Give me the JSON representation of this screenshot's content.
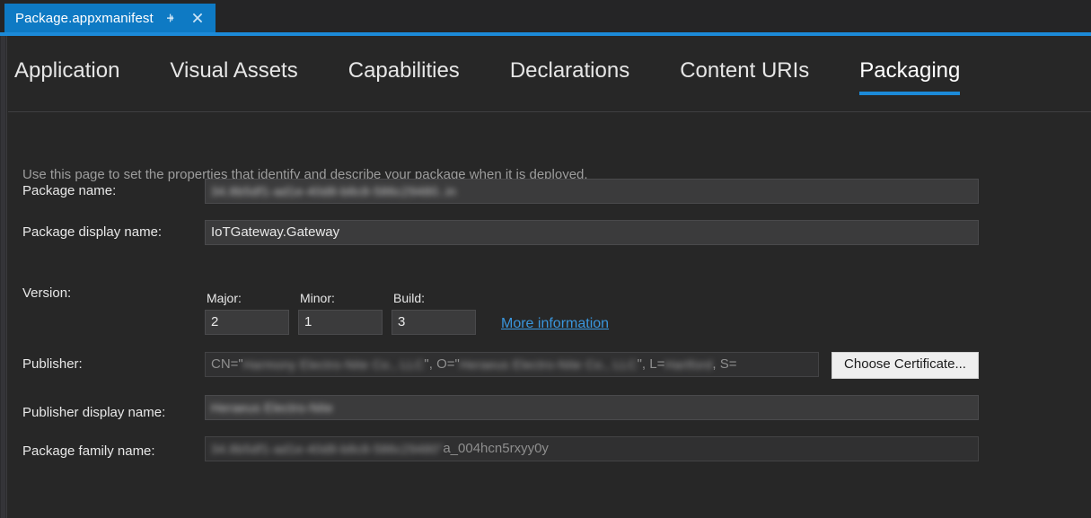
{
  "window": {
    "document_tab": {
      "title": "Package.appxmanifest",
      "pin_icon": "pin-icon",
      "close_icon": "close-icon"
    }
  },
  "accent_color": "#1c8ad8",
  "page_tabs": [
    {
      "label": "Application",
      "selected": false
    },
    {
      "label": "Visual Assets",
      "selected": false
    },
    {
      "label": "Capabilities",
      "selected": false
    },
    {
      "label": "Declarations",
      "selected": false
    },
    {
      "label": "Content URIs",
      "selected": false
    },
    {
      "label": "Packaging",
      "selected": true
    }
  ],
  "description": "Use this page to set the properties that identify and describe your package when it is deployed.",
  "fields": {
    "package_name": {
      "label": "Package name:",
      "value": "34.8b5df1-ad1e-40d8-b8c8-586c29480..in",
      "redacted": true
    },
    "package_display_name": {
      "label": "Package display name:",
      "value": "IoTGateway.Gateway",
      "redacted": false
    },
    "version": {
      "label": "Version:",
      "major": {
        "label": "Major:",
        "value": "2"
      },
      "minor": {
        "label": "Minor:",
        "value": "1"
      },
      "build": {
        "label": "Build:",
        "value": "3"
      },
      "more_info_link": "More information"
    },
    "publisher": {
      "label": "Publisher:",
      "prefix": "CN=\"",
      "redacted_1": "Harmony Electro-Nite Co., LLC",
      "mid_1": "\", O=\"",
      "redacted_2": "Heraeus Electro-Nite Co., LLC",
      "mid_2": "\", L=",
      "redacted_3": "Hartford",
      "suffix": ", S=",
      "choose_certificate_button": "Choose Certificate..."
    },
    "publisher_display_name": {
      "label": "Publisher display name:",
      "value": "Heraeus Electro-Nite",
      "redacted": true
    },
    "package_family_name": {
      "label": "Package family name:",
      "redacted_prefix": "34.8b5df1-ad1e-40d8-b8c8-586c29480\"",
      "visible_suffix": "a_004hcn5rxyy0y"
    }
  }
}
